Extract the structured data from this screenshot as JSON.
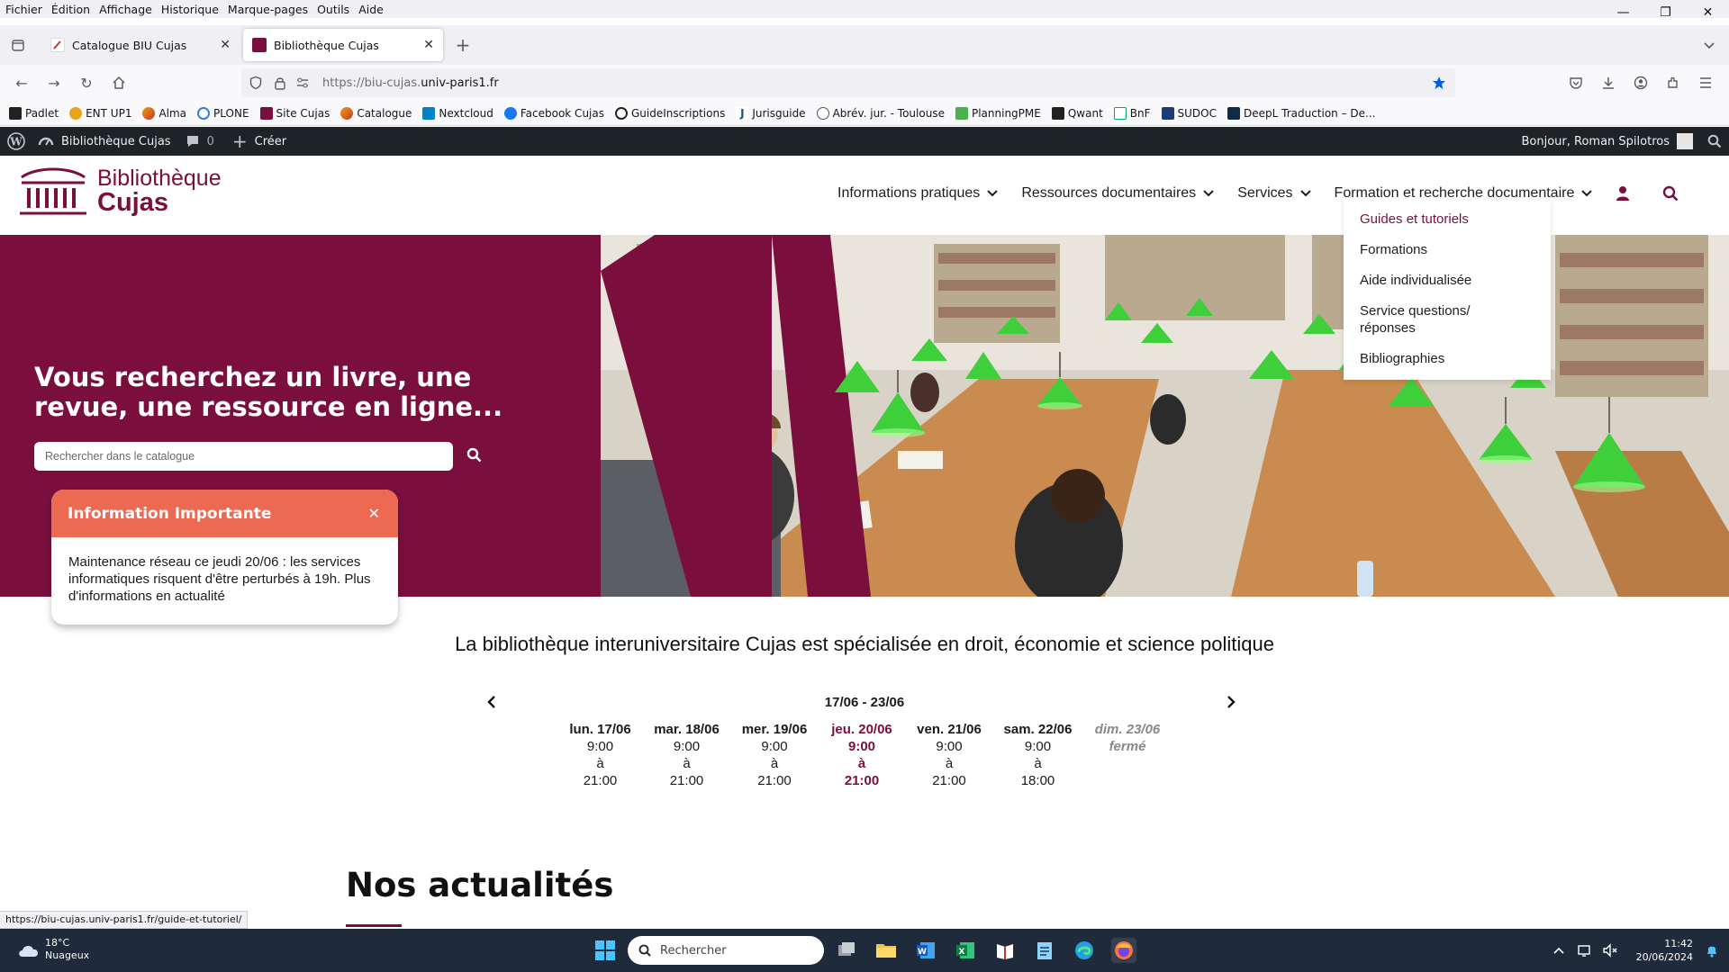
{
  "browser": {
    "menu": [
      "Fichier",
      "Édition",
      "Affichage",
      "Historique",
      "Marque-pages",
      "Outils",
      "Aide"
    ],
    "tabs": [
      {
        "label": "Catalogue BIU Cujas"
      },
      {
        "label": "Bibliothèque Cujas"
      }
    ],
    "url_prefix": "https://biu-cujas.",
    "url_domain": "univ-paris1.fr",
    "bookmarks": [
      "Padlet",
      "ENT UP1",
      "Alma",
      "PLONE",
      "Site Cujas",
      "Catalogue",
      "Nextcloud",
      "Facebook Cujas",
      "GuideInscriptions",
      "Jurisguide",
      "Abrév. jur. - Toulouse",
      "PlanningPME",
      "Qwant",
      "BnF",
      "SUDOC",
      "DeepL Traduction – De..."
    ],
    "status_url": "https://biu-cujas.univ-paris1.fr/guide-et-tutoriel/"
  },
  "wpbar": {
    "site": "Bibliothèque Cujas",
    "comments": "0",
    "create": "Créer",
    "greeting": "Bonjour, Roman Spilotros"
  },
  "header": {
    "logo_line1": "Bibliothèque",
    "logo_line2": "Cujas",
    "nav": [
      {
        "label": "Informations pratiques"
      },
      {
        "label": "Ressources documentaires"
      },
      {
        "label": "Services"
      },
      {
        "label": "Formation et recherche documentaire"
      }
    ],
    "dropdown": [
      "Guides et tutoriels",
      "Formations",
      "Aide individualisée",
      "Service questions/ réponses",
      "Bibliographies"
    ]
  },
  "hero": {
    "title": "Vous recherchez un livre, une revue, une ressource en ligne...",
    "search_placeholder": "Rechercher dans le catalogue"
  },
  "info": {
    "title": "Information Importante",
    "text": "Maintenance réseau ce jeudi 20/06 : les services informatiques risquent d'être perturbés à 19h. Plus d'informations en actualité"
  },
  "content": {
    "tagline": "La bibliothèque interuniversitaire Cujas est spécialisée en droit, économie et science politique",
    "week": "17/06 - 23/06",
    "days": [
      {
        "date": "lun. 17/06",
        "open": "9:00",
        "sep": "à",
        "close": "21:00"
      },
      {
        "date": "mar. 18/06",
        "open": "9:00",
        "sep": "à",
        "close": "21:00"
      },
      {
        "date": "mer. 19/06",
        "open": "9:00",
        "sep": "à",
        "close": "21:00"
      },
      {
        "date": "jeu. 20/06",
        "open": "9:00",
        "sep": "à",
        "close": "21:00"
      },
      {
        "date": "ven. 21/06",
        "open": "9:00",
        "sep": "à",
        "close": "21:00"
      },
      {
        "date": "sam. 22/06",
        "open": "9:00",
        "sep": "à",
        "close": "18:00"
      }
    ],
    "closed_day": {
      "date": "dim. 23/06",
      "status": "fermé"
    },
    "news_title": "Nos actualités"
  },
  "taskbar": {
    "temp": "18°C",
    "weather": "Nuageux",
    "search": "Rechercher",
    "time": "11:42",
    "date": "20/06/2024"
  },
  "colors": {
    "brand": "#7a0f3e",
    "info_header": "#ec6a52",
    "lamp_green": "#3fcf3a"
  }
}
